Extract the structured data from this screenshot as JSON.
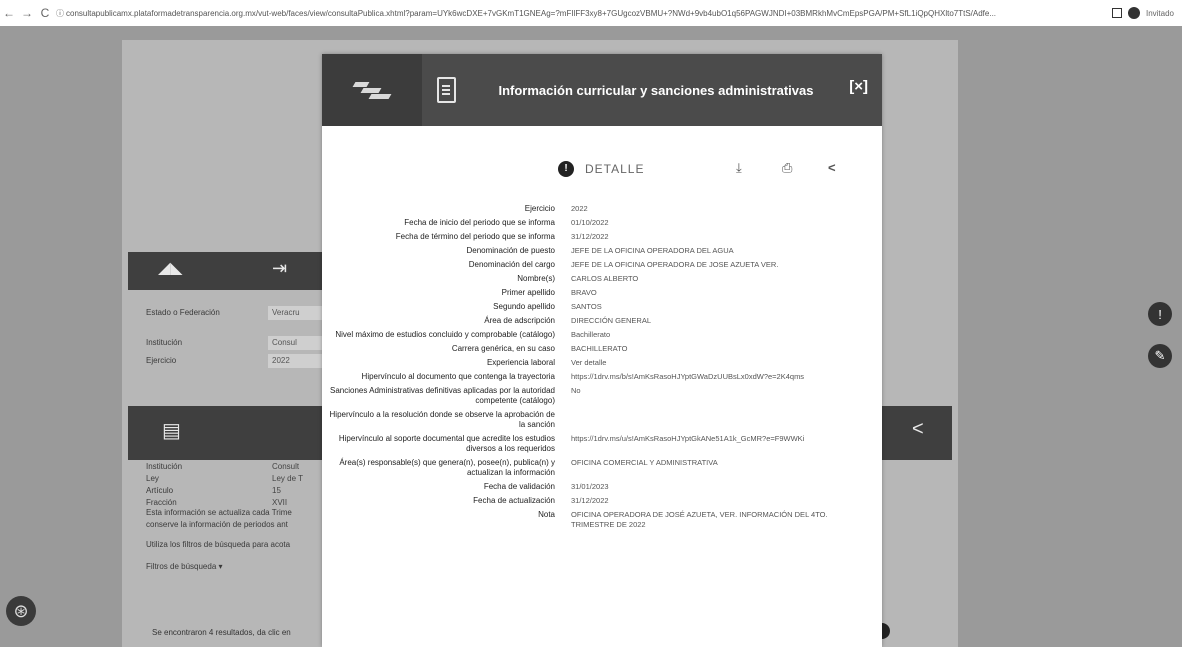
{
  "browser": {
    "url": "consultapublicamx.plataformadetransparencia.org.mx/vut-web/faces/view/consultaPublica.xhtml?param=UYk6wcDXE+7vGKmT1GNEAg=?mFIlFF3xy8+7GUgcozVBMU+?NWd+9vb4ubO1q56PAGWJNDI+03BMRkhMvCmEpsPGA/PM+SfL1iQpQHXlto7TtS/Adfe...",
    "guest_label": "Invitado",
    "back": "←",
    "forward": "→",
    "reload": "C"
  },
  "background": {
    "rows1": [
      {
        "label": "Estado o Federación",
        "value": "Veracru"
      },
      {
        "label": "Institución",
        "value": "Consul"
      },
      {
        "label": "Ejercicio",
        "value": "2022"
      }
    ],
    "rows2": [
      {
        "label": "Institución",
        "value": "Consult"
      },
      {
        "label": "Ley",
        "value": "Ley de T"
      },
      {
        "label": "Artículo",
        "value": "15"
      },
      {
        "label": "Fracción",
        "value": "XVII"
      }
    ],
    "note1": "Esta información se actualiza cada Trime",
    "note2": "conserve la información de periodos ant",
    "note3": "Utiliza los filtros de búsqueda para acota",
    "filters": "Filtros de búsqueda",
    "results": "Se encontraron 4 resultados, da clic en"
  },
  "modal": {
    "title": "Información curricular y sanciones administrativas",
    "close": "[×]",
    "detail": "DETALLE",
    "download": "⤓",
    "print": "⎙",
    "share": "<",
    "fields": [
      {
        "label": "Ejercicio",
        "value": "2022"
      },
      {
        "label": "Fecha de inicio del periodo que se informa",
        "value": "01/10/2022"
      },
      {
        "label": "Fecha de término del periodo que se informa",
        "value": "31/12/2022"
      },
      {
        "label": "Denominación de puesto",
        "value": "JEFE DE LA OFICINA OPERADORA DEL AGUA"
      },
      {
        "label": "Denominación del cargo",
        "value": "JEFE DE LA OFICINA OPERADORA DE JOSE AZUETA VER."
      },
      {
        "label": "Nombre(s)",
        "value": "CARLOS ALBERTO"
      },
      {
        "label": "Primer apellido",
        "value": "BRAVO"
      },
      {
        "label": "Segundo apellido",
        "value": "SANTOS"
      },
      {
        "label": "Área de adscripción",
        "value": "DIRECCIÓN GENERAL"
      },
      {
        "label": "Nivel máximo de estudios concluido y comprobable (catálogo)",
        "value": "Bachillerato"
      },
      {
        "label": "Carrera genérica, en su caso",
        "value": "BACHILLERATO"
      },
      {
        "label": "Experiencia laboral",
        "value": "Ver detalle"
      },
      {
        "label": "Hipervínculo al documento que contenga la trayectoria",
        "value": "https://1drv.ms/b/s!AmKsRasoHJYptGWaDzUUBsLx0xdW?e=2K4qms"
      },
      {
        "label": "Sanciones Administrativas definitivas aplicadas por la autoridad competente (catálogo)",
        "value": "No"
      },
      {
        "label": "Hipervínculo a la resolución donde se observe la aprobación de la sanción",
        "value": ""
      },
      {
        "label": "Hipervínculo al soporte documental que acredite los estudios diversos a los requeridos",
        "value": "https://1drv.ms/u/s!AmKsRasoHJYptGkANe51A1k_GcMR?e=F9WWKi"
      },
      {
        "label": "Área(s) responsable(s) que genera(n), posee(n), publica(n) y actualizan la información",
        "value": "OFICINA COMERCIAL Y ADMINISTRATIVA"
      },
      {
        "label": "Fecha de validación",
        "value": "31/01/2023"
      },
      {
        "label": "Fecha de actualización",
        "value": "31/12/2022"
      },
      {
        "label": "Nota",
        "value": "OFICINA OPERADORA DE JOSÉ AZUETA, VER. INFORMACIÓN DEL 4TO. TRIMESTRE DE 2022"
      }
    ]
  }
}
